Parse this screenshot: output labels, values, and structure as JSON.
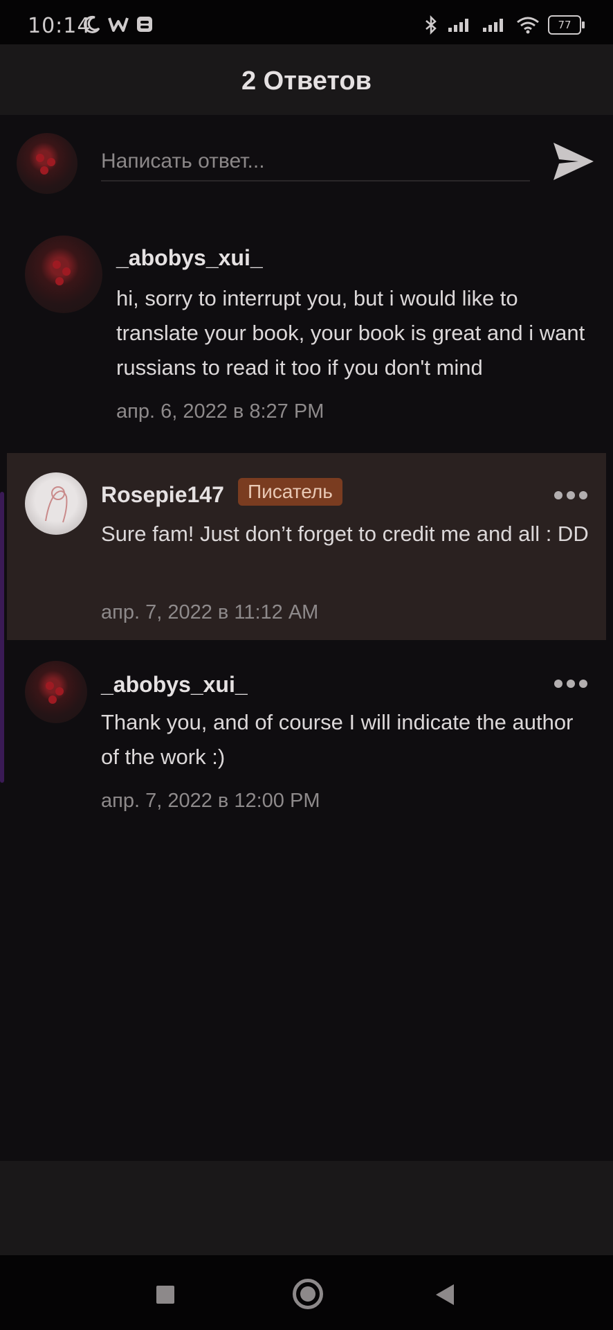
{
  "status_bar": {
    "time": "10:14",
    "battery": "77"
  },
  "header": {
    "title": "2 Ответов"
  },
  "composer": {
    "placeholder": "Написать ответ..."
  },
  "comments": [
    {
      "username": "_abobys_xui_",
      "text": "hi, sorry to interrupt you, but i would like to translate your book, your book is great and i want russians to read it too if you don't mind",
      "date": "апр. 6, 2022 в 8:27 PM"
    },
    {
      "username": "Rosepie147",
      "badge": "Писатель",
      "text": "Sure fam! Just don’t forget to credit me and all : DD",
      "date": "апр. 7, 2022 в 11:12 AM"
    },
    {
      "username": "_abobys_xui_",
      "text": "Thank you, and of course I will indicate the author of the work :)",
      "date": "апр. 7, 2022 в 12:00 PM"
    }
  ],
  "icons": {
    "status_left": [
      "moon-icon",
      "w-app-icon",
      "app-notification-icon"
    ],
    "status_right": [
      "bluetooth-icon",
      "signal-icon",
      "signal-icon",
      "wifi-icon",
      "battery-icon"
    ],
    "send": "send-icon",
    "more": "more-dots-icon",
    "nav": [
      "recent-apps-icon",
      "home-icon",
      "back-icon"
    ]
  },
  "colors": {
    "badge": "#7a3c20",
    "highlight": "#2a2120",
    "background": "#0f0d10"
  }
}
